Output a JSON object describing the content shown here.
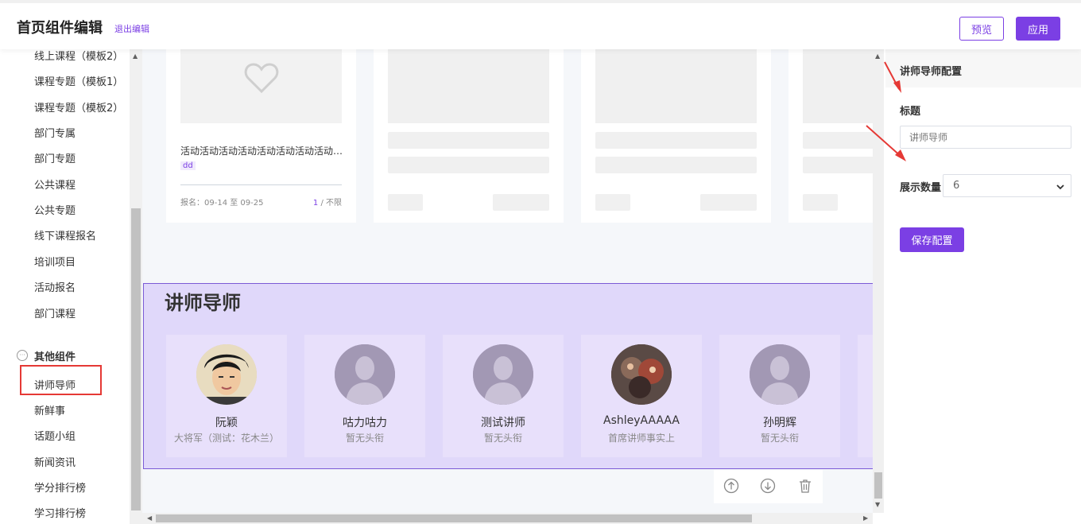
{
  "header": {
    "title": "首页组件编辑",
    "exit_label": "退出编辑",
    "preview_label": "预览",
    "apply_label": "应用"
  },
  "sidebar": {
    "items": [
      "线上课程（模板2）",
      "课程专题（模板1）",
      "课程专题（模板2）",
      "部门专属",
      "部门专题",
      "公共课程",
      "公共专题",
      "线下课程报名",
      "培训项目",
      "活动报名",
      "部门课程"
    ],
    "group_title": "其他组件",
    "group_items": [
      "讲师导师",
      "新鲜事",
      "话题小组",
      "新闻资讯",
      "学分排行榜",
      "学习排行榜"
    ]
  },
  "activity_card": {
    "title": "活动活动活动活动活动活动活动活动活动",
    "tag": "dd",
    "date": "报名：09-14 至 09-25",
    "count_current": "1",
    "count_rest": " / 不限"
  },
  "lecturers": {
    "title": "讲师导师",
    "items": [
      {
        "name": "阮颖",
        "subtitle": "大将军（测试：花木兰）",
        "avatar": "photo-avatar"
      },
      {
        "name": "咕力咕力",
        "subtitle": "暂无头衔",
        "avatar": "default-avatar"
      },
      {
        "name": "测试讲师",
        "subtitle": "暂无头衔",
        "avatar": "default-avatar"
      },
      {
        "name": "AshleyAAAAA",
        "subtitle": "首席讲师事实上",
        "avatar": "game-avatar"
      },
      {
        "name": "孙明辉",
        "subtitle": "暂无头衔",
        "avatar": "default-avatar"
      }
    ]
  },
  "panel": {
    "title": "讲师导师配置",
    "label_title": "标题",
    "title_placeholder": "讲师导师",
    "label_count": "展示数量",
    "count_value": "6",
    "save_label": "保存配置"
  },
  "colors": {
    "accent": "#7b3fe4",
    "section_bg": "#e0d8fa",
    "highlight_red": "#e53935"
  }
}
